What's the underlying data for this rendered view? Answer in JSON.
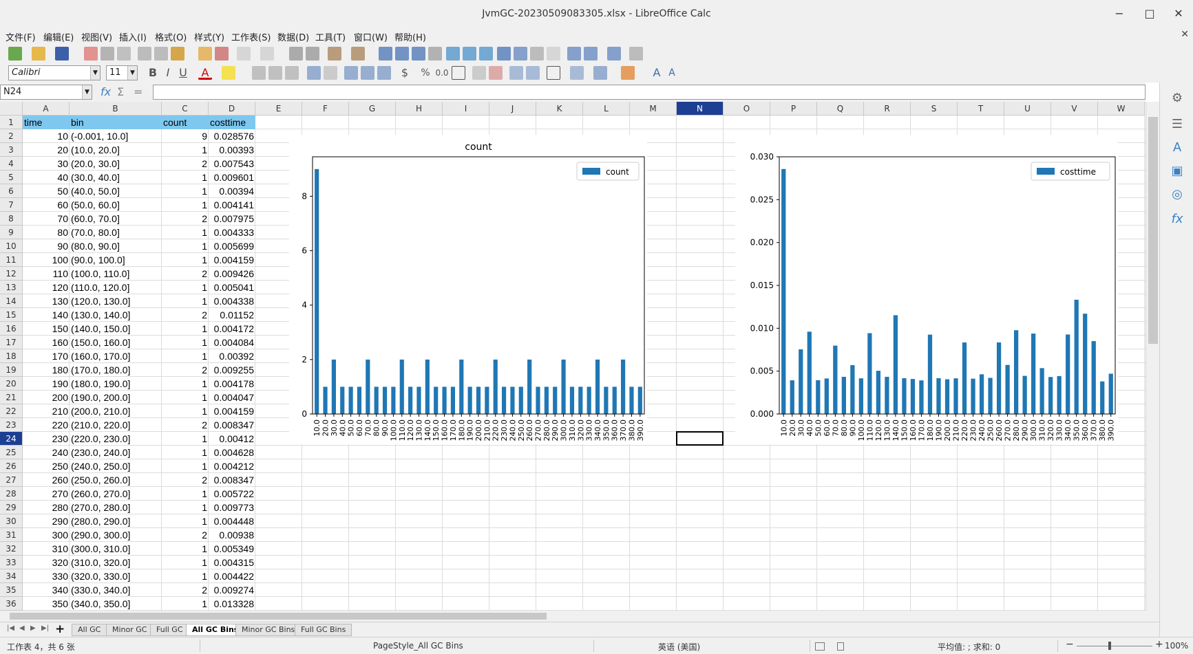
{
  "window": {
    "title": "JvmGC-20230509083305.xlsx - LibreOffice Calc",
    "minimize": "−",
    "maximize": "□",
    "close": "✕"
  },
  "menu": {
    "items": [
      "文件(F)",
      "编辑(E)",
      "视图(V)",
      "插入(I)",
      "格式(O)",
      "样式(Y)",
      "工作表(S)",
      "数据(D)",
      "工具(T)",
      "窗口(W)",
      "帮助(H)"
    ],
    "close_doc": "✕"
  },
  "format_toolbar": {
    "font_name": "Calibri",
    "font_size": "11"
  },
  "formula_bar": {
    "name_box": "N24",
    "content": ""
  },
  "columns": [
    "A",
    "B",
    "C",
    "D",
    "E",
    "F",
    "G",
    "H",
    "I",
    "J",
    "K",
    "L",
    "M",
    "N",
    "O",
    "P",
    "Q",
    "R",
    "S",
    "T",
    "U",
    "V",
    "W"
  ],
  "selected_cell": {
    "col": "N",
    "row": "24"
  },
  "headers": [
    "time",
    "bin",
    "count",
    "costtime"
  ],
  "rows": [
    [
      "10",
      "(-0.001, 10.0]",
      "9",
      "0.028576"
    ],
    [
      "20",
      "(10.0, 20.0]",
      "1",
      "0.00393"
    ],
    [
      "30",
      "(20.0, 30.0]",
      "2",
      "0.007543"
    ],
    [
      "40",
      "(30.0, 40.0]",
      "1",
      "0.009601"
    ],
    [
      "50",
      "(40.0, 50.0]",
      "1",
      "0.00394"
    ],
    [
      "60",
      "(50.0, 60.0]",
      "1",
      "0.004141"
    ],
    [
      "70",
      "(60.0, 70.0]",
      "2",
      "0.007975"
    ],
    [
      "80",
      "(70.0, 80.0]",
      "1",
      "0.004333"
    ],
    [
      "90",
      "(80.0, 90.0]",
      "1",
      "0.005699"
    ],
    [
      "100",
      "(90.0, 100.0]",
      "1",
      "0.004159"
    ],
    [
      "110",
      "(100.0, 110.0]",
      "2",
      "0.009426"
    ],
    [
      "120",
      "(110.0, 120.0]",
      "1",
      "0.005041"
    ],
    [
      "130",
      "(120.0, 130.0]",
      "1",
      "0.004338"
    ],
    [
      "140",
      "(130.0, 140.0]",
      "2",
      "0.01152"
    ],
    [
      "150",
      "(140.0, 150.0]",
      "1",
      "0.004172"
    ],
    [
      "160",
      "(150.0, 160.0]",
      "1",
      "0.004084"
    ],
    [
      "170",
      "(160.0, 170.0]",
      "1",
      "0.00392"
    ],
    [
      "180",
      "(170.0, 180.0]",
      "2",
      "0.009255"
    ],
    [
      "190",
      "(180.0, 190.0]",
      "1",
      "0.004178"
    ],
    [
      "200",
      "(190.0, 200.0]",
      "1",
      "0.004047"
    ],
    [
      "210",
      "(200.0, 210.0]",
      "1",
      "0.004159"
    ],
    [
      "220",
      "(210.0, 220.0]",
      "2",
      "0.008347"
    ],
    [
      "230",
      "(220.0, 230.0]",
      "1",
      "0.00412"
    ],
    [
      "240",
      "(230.0, 240.0]",
      "1",
      "0.004628"
    ],
    [
      "250",
      "(240.0, 250.0]",
      "1",
      "0.004212"
    ],
    [
      "260",
      "(250.0, 260.0]",
      "2",
      "0.008347"
    ],
    [
      "270",
      "(260.0, 270.0]",
      "1",
      "0.005722"
    ],
    [
      "280",
      "(270.0, 280.0]",
      "1",
      "0.009773"
    ],
    [
      "290",
      "(280.0, 290.0]",
      "1",
      "0.004448"
    ],
    [
      "300",
      "(290.0, 300.0]",
      "2",
      "0.00938"
    ],
    [
      "310",
      "(300.0, 310.0]",
      "1",
      "0.005349"
    ],
    [
      "320",
      "(310.0, 320.0]",
      "1",
      "0.004315"
    ],
    [
      "330",
      "(320.0, 330.0]",
      "1",
      "0.004422"
    ],
    [
      "340",
      "(330.0, 340.0]",
      "2",
      "0.009274"
    ],
    [
      "350",
      "(340.0, 350.0]",
      "1",
      "0.013328"
    ]
  ],
  "chart_data": [
    {
      "type": "bar",
      "title": "count",
      "legend": {
        "placement": "top-right"
      },
      "color": "#1f77b4",
      "ylim": [
        0,
        9.45
      ],
      "yticks": [
        "0",
        "2",
        "4",
        "6",
        "8"
      ],
      "categories": [
        "10.0",
        "20.0",
        "30.0",
        "40.0",
        "50.0",
        "60.0",
        "70.0",
        "80.0",
        "90.0",
        "100.0",
        "110.0",
        "120.0",
        "130.0",
        "140.0",
        "150.0",
        "160.0",
        "170.0",
        "180.0",
        "190.0",
        "200.0",
        "210.0",
        "220.0",
        "230.0",
        "240.0",
        "250.0",
        "260.0",
        "270.0",
        "280.0",
        "290.0",
        "300.0",
        "310.0",
        "320.0",
        "330.0",
        "340.0",
        "350.0",
        "360.0",
        "370.0",
        "380.0",
        "390.0"
      ],
      "series": [
        {
          "name": "count",
          "values": [
            9,
            1,
            2,
            1,
            1,
            1,
            2,
            1,
            1,
            1,
            2,
            1,
            1,
            2,
            1,
            1,
            1,
            2,
            1,
            1,
            1,
            2,
            1,
            1,
            1,
            2,
            1,
            1,
            1,
            2,
            1,
            1,
            1,
            2,
            1,
            1,
            2,
            1,
            1
          ]
        }
      ]
    },
    {
      "type": "bar",
      "title": "",
      "legend": {
        "placement": "top-right"
      },
      "color": "#1f77b4",
      "ylim": [
        0,
        0.03
      ],
      "yticks": [
        "0.000",
        "0.005",
        "0.010",
        "0.015",
        "0.020",
        "0.025",
        "0.030"
      ],
      "categories": [
        "10.0",
        "20.0",
        "30.0",
        "40.0",
        "50.0",
        "60.0",
        "70.0",
        "80.0",
        "90.0",
        "100.0",
        "110.0",
        "120.0",
        "130.0",
        "140.0",
        "150.0",
        "160.0",
        "170.0",
        "180.0",
        "190.0",
        "200.0",
        "210.0",
        "220.0",
        "230.0",
        "240.0",
        "250.0",
        "260.0",
        "270.0",
        "280.0",
        "290.0",
        "300.0",
        "310.0",
        "320.0",
        "330.0",
        "340.0",
        "350.0",
        "360.0",
        "370.0",
        "380.0",
        "390.0"
      ],
      "series": [
        {
          "name": "costtime",
          "values": [
            0.028576,
            0.00393,
            0.007543,
            0.009601,
            0.00394,
            0.004141,
            0.007975,
            0.004333,
            0.005699,
            0.004159,
            0.009426,
            0.005041,
            0.004338,
            0.01152,
            0.004172,
            0.004084,
            0.00392,
            0.009255,
            0.004178,
            0.004047,
            0.004159,
            0.008347,
            0.00412,
            0.004628,
            0.004212,
            0.008347,
            0.005722,
            0.009773,
            0.004448,
            0.00938,
            0.005349,
            0.004315,
            0.004422,
            0.009274,
            0.013328,
            0.0117,
            0.0085,
            0.0038,
            0.0047
          ]
        }
      ]
    }
  ],
  "sheet_tabs": [
    "All GC",
    "Minor GC",
    "Full GC",
    "All GC Bins",
    "Minor GC Bins",
    "Full GC Bins"
  ],
  "active_tab": "All GC Bins",
  "status": {
    "sheet_info": "工作表 4，共 6 张",
    "page_style": "PageStyle_All GC Bins",
    "language": "英语 (美国)",
    "summary": "平均值: ; 求和: 0",
    "zoom": "100%"
  }
}
